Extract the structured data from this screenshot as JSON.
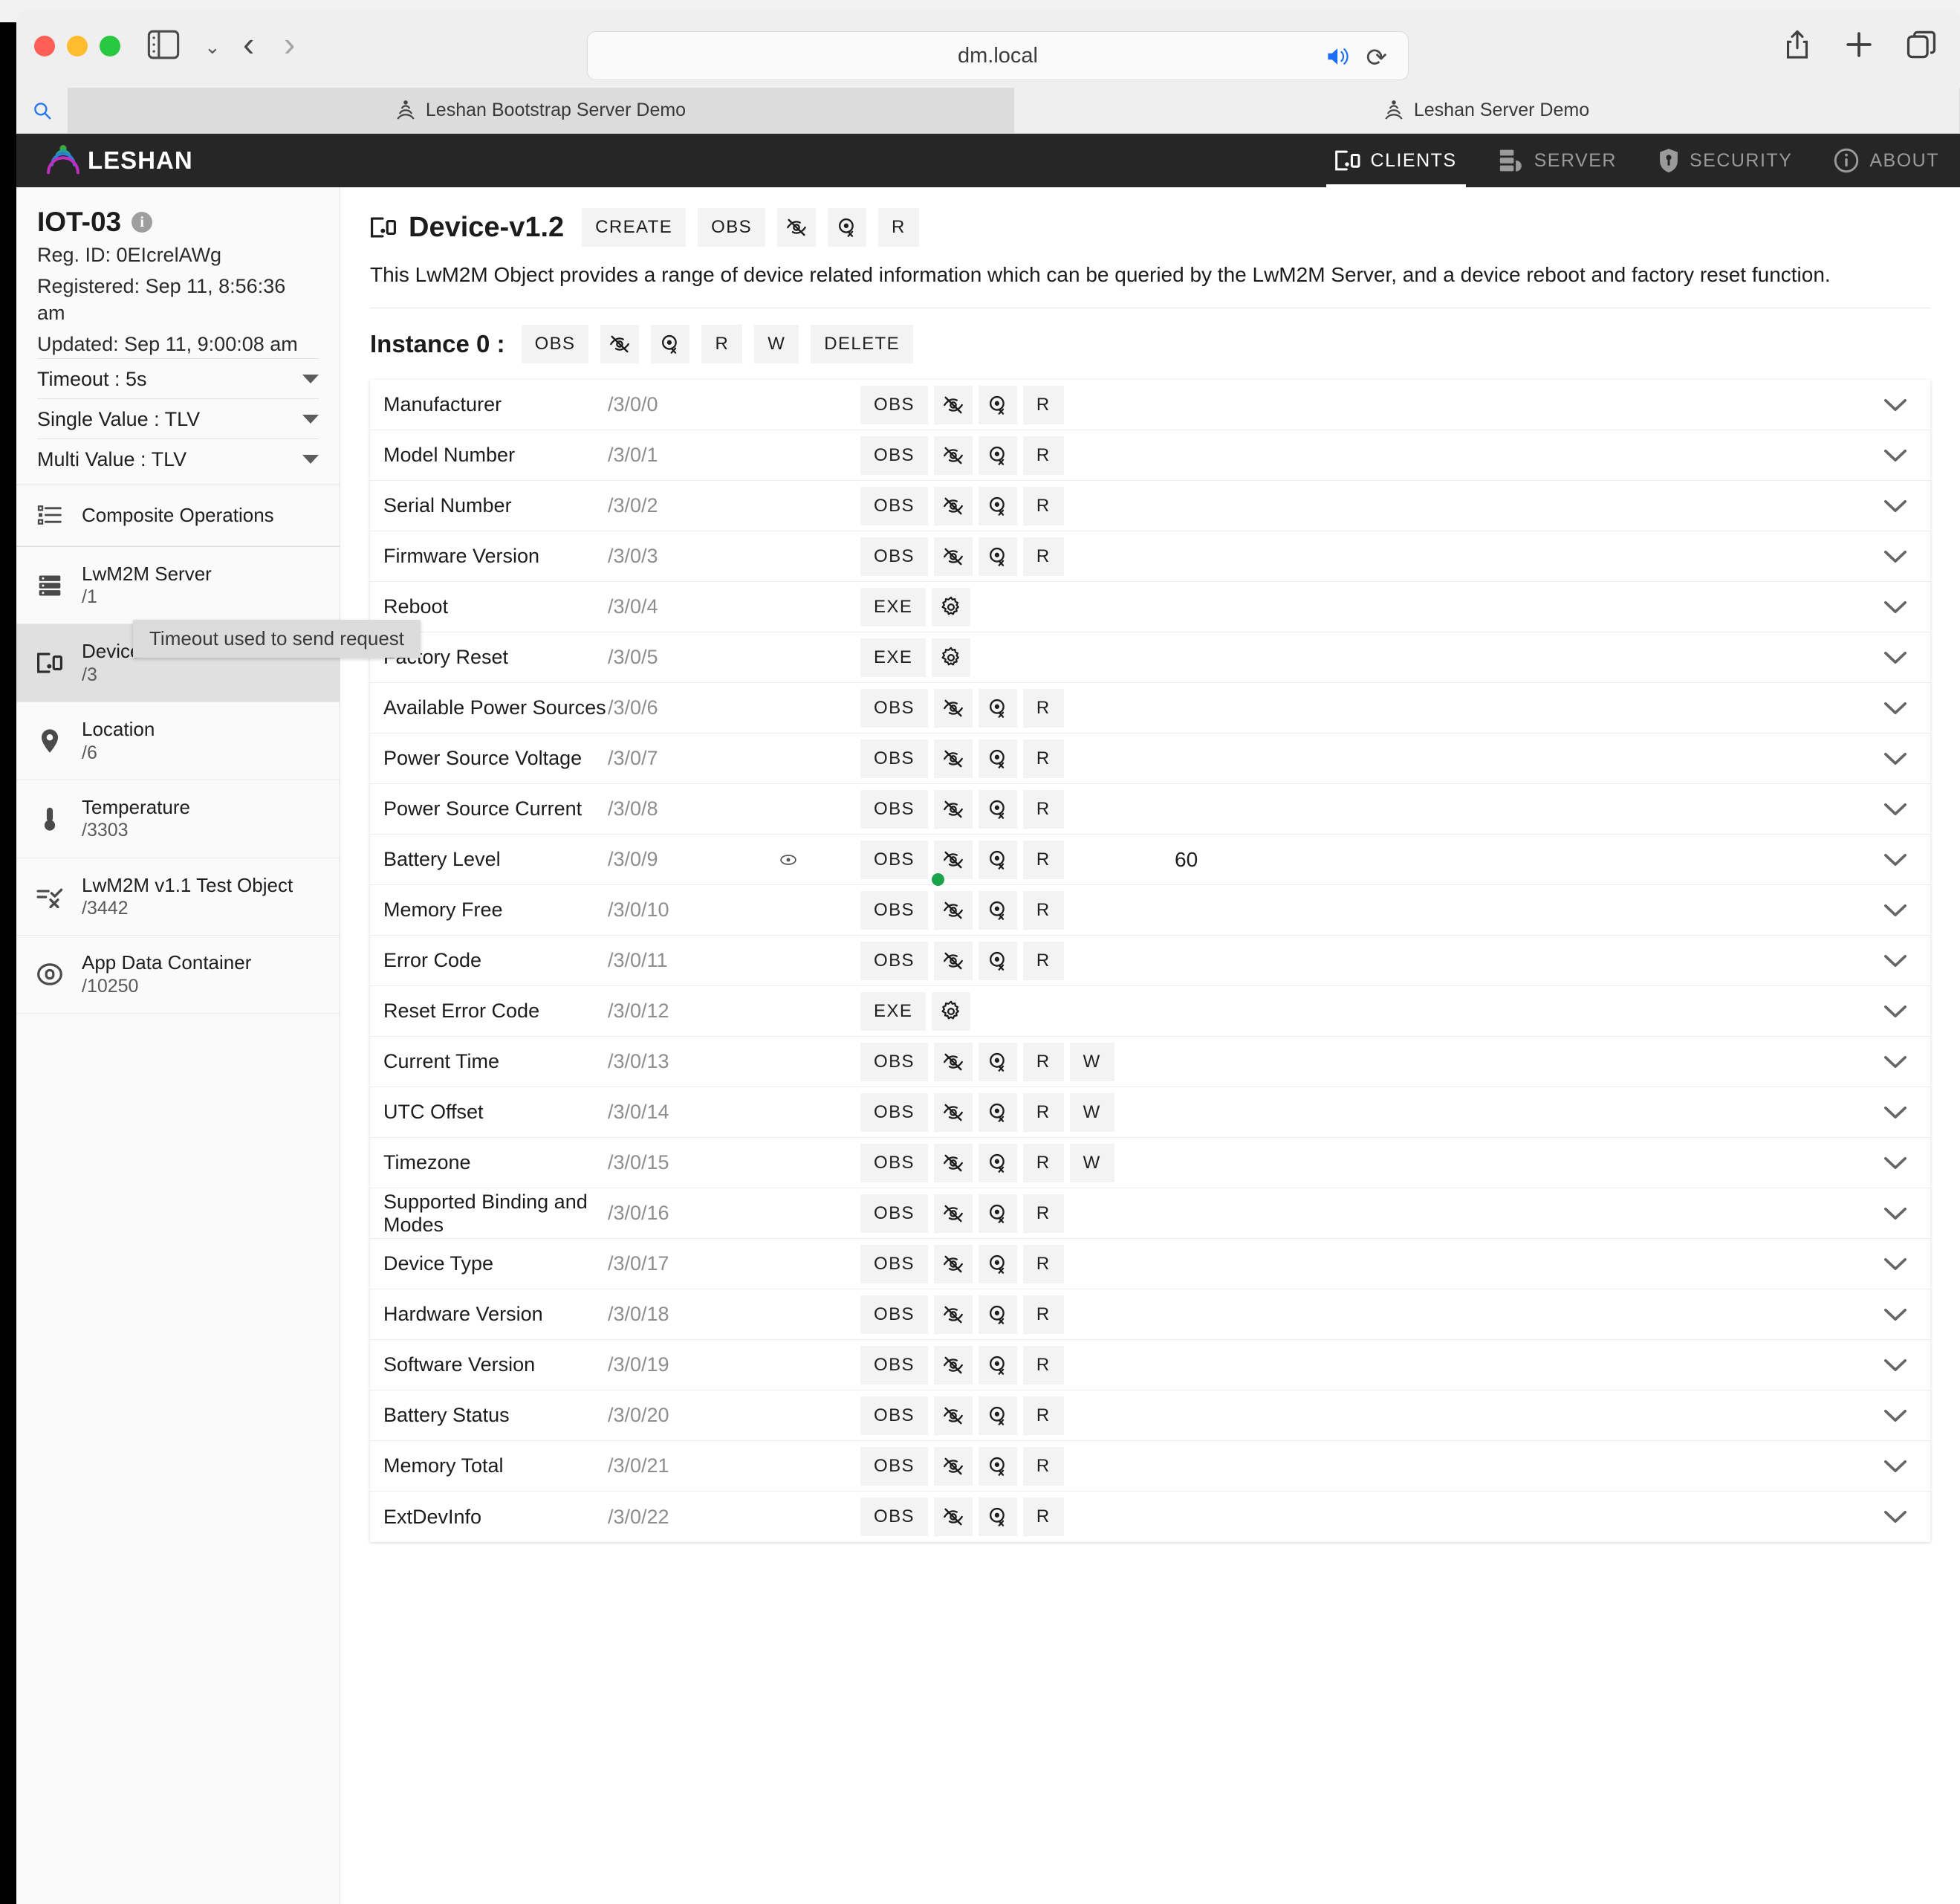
{
  "browser": {
    "url": "dm.local",
    "tabs": [
      {
        "title": "Leshan Bootstrap Server Demo",
        "active": true
      },
      {
        "title": "Leshan Server Demo",
        "active": false
      }
    ],
    "icons": {
      "sidebar": "sidebar-toggle-icon",
      "back": "back-arrow-icon",
      "forward": "forward-arrow-icon",
      "speaker": "speaker-icon",
      "reload": "reload-icon",
      "share": "share-icon",
      "newtab": "plus-icon",
      "tabs": "tab-overview-icon",
      "search": "search-icon"
    }
  },
  "topnav": {
    "brand": "LESHAN",
    "items": [
      {
        "label": "CLIENTS",
        "icon": "device-icon",
        "active": true
      },
      {
        "label": "SERVER",
        "icon": "server-icon",
        "active": false
      },
      {
        "label": "SECURITY",
        "icon": "shield-key-icon",
        "active": false
      },
      {
        "label": "ABOUT",
        "icon": "info-circle-icon",
        "active": false
      }
    ]
  },
  "sidebar": {
    "device_name": "IOT-03",
    "reg_id": "Reg. ID: 0EIcrelAWg",
    "registered": "Registered: Sep 11, 8:56:36 am",
    "updated": "Updated: Sep 11, 9:00:08 am",
    "selects": [
      {
        "label": "Timeout : 5s"
      },
      {
        "label": "Single Value : TLV"
      },
      {
        "label": "Multi Value : TLV"
      }
    ],
    "tooltip": "Timeout used to send request",
    "composite": {
      "label": "Composite Operations",
      "icon": "list-icon"
    },
    "objects": [
      {
        "name": "LwM2M Server",
        "path": "/1",
        "icon": "server-icon",
        "selected": false
      },
      {
        "name": "Device",
        "path": "/3",
        "icon": "device-icon",
        "selected": true
      },
      {
        "name": "Location",
        "path": "/6",
        "icon": "map-pin-icon",
        "selected": false
      },
      {
        "name": "Temperature",
        "path": "/3303",
        "icon": "thermometer-icon",
        "selected": false
      },
      {
        "name": "LwM2M v1.1 Test Object",
        "path": "/3442",
        "icon": "test-object-icon",
        "selected": false
      },
      {
        "name": "App Data Container",
        "path": "/10250",
        "icon": "data-container-icon",
        "selected": false
      }
    ]
  },
  "main": {
    "object_title": "Device-v1.2",
    "object_icon": "device-icon",
    "object_buttons": [
      {
        "label": "CREATE",
        "kind": "text"
      },
      {
        "label": "OBS",
        "kind": "text"
      },
      {
        "label": "",
        "kind": "icon",
        "icon": "eye-off-icon"
      },
      {
        "label": "",
        "kind": "icon",
        "icon": "eye-check-icon"
      },
      {
        "label": "R",
        "kind": "text"
      }
    ],
    "description": "This LwM2M Object provides a range of device related information which can be queried by the LwM2M Server, and a device reboot and factory reset function.",
    "instance_label": "Instance 0 :",
    "instance_buttons": [
      {
        "label": "OBS",
        "kind": "text"
      },
      {
        "label": "",
        "kind": "icon",
        "icon": "eye-off-icon"
      },
      {
        "label": "",
        "kind": "icon",
        "icon": "eye-check-icon"
      },
      {
        "label": "R",
        "kind": "text"
      },
      {
        "label": "W",
        "kind": "text"
      },
      {
        "label": "DELETE",
        "kind": "text"
      }
    ],
    "resources": [
      {
        "name": "Manufacturer",
        "path": "/3/0/0",
        "ops": [
          "OBS",
          "eye-off-icon",
          "eye-check-icon",
          "R"
        ],
        "value": "",
        "eye": false,
        "obs_dot": false
      },
      {
        "name": "Model Number",
        "path": "/3/0/1",
        "ops": [
          "OBS",
          "eye-off-icon",
          "eye-check-icon",
          "R"
        ],
        "value": "",
        "eye": false,
        "obs_dot": false
      },
      {
        "name": "Serial Number",
        "path": "/3/0/2",
        "ops": [
          "OBS",
          "eye-off-icon",
          "eye-check-icon",
          "R"
        ],
        "value": "",
        "eye": false,
        "obs_dot": false
      },
      {
        "name": "Firmware Version",
        "path": "/3/0/3",
        "ops": [
          "OBS",
          "eye-off-icon",
          "eye-check-icon",
          "R"
        ],
        "value": "",
        "eye": false,
        "obs_dot": false
      },
      {
        "name": "Reboot",
        "path": "/3/0/4",
        "ops": [
          "EXE",
          "gear-icon"
        ],
        "value": "",
        "eye": false,
        "obs_dot": false
      },
      {
        "name": "Factory Reset",
        "path": "/3/0/5",
        "ops": [
          "EXE",
          "gear-icon"
        ],
        "value": "",
        "eye": false,
        "obs_dot": false
      },
      {
        "name": "Available Power Sources",
        "path": "/3/0/6",
        "ops": [
          "OBS",
          "eye-off-icon",
          "eye-check-icon",
          "R"
        ],
        "value": "",
        "eye": false,
        "obs_dot": false
      },
      {
        "name": "Power Source Voltage",
        "path": "/3/0/7",
        "ops": [
          "OBS",
          "eye-off-icon",
          "eye-check-icon",
          "R"
        ],
        "value": "",
        "eye": false,
        "obs_dot": false
      },
      {
        "name": "Power Source Current",
        "path": "/3/0/8",
        "ops": [
          "OBS",
          "eye-off-icon",
          "eye-check-icon",
          "R"
        ],
        "value": "",
        "eye": false,
        "obs_dot": false
      },
      {
        "name": "Battery Level",
        "path": "/3/0/9",
        "ops": [
          "OBS",
          "eye-off-icon",
          "eye-check-icon",
          "R"
        ],
        "value": "60",
        "eye": true,
        "obs_dot": true
      },
      {
        "name": "Memory Free",
        "path": "/3/0/10",
        "ops": [
          "OBS",
          "eye-off-icon",
          "eye-check-icon",
          "R"
        ],
        "value": "",
        "eye": false,
        "obs_dot": false
      },
      {
        "name": "Error Code",
        "path": "/3/0/11",
        "ops": [
          "OBS",
          "eye-off-icon",
          "eye-check-icon",
          "R"
        ],
        "value": "",
        "eye": false,
        "obs_dot": false
      },
      {
        "name": "Reset Error Code",
        "path": "/3/0/12",
        "ops": [
          "EXE",
          "gear-icon"
        ],
        "value": "",
        "eye": false,
        "obs_dot": false
      },
      {
        "name": "Current Time",
        "path": "/3/0/13",
        "ops": [
          "OBS",
          "eye-off-icon",
          "eye-check-icon",
          "R",
          "W"
        ],
        "value": "",
        "eye": false,
        "obs_dot": false
      },
      {
        "name": "UTC Offset",
        "path": "/3/0/14",
        "ops": [
          "OBS",
          "eye-off-icon",
          "eye-check-icon",
          "R",
          "W"
        ],
        "value": "",
        "eye": false,
        "obs_dot": false
      },
      {
        "name": "Timezone",
        "path": "/3/0/15",
        "ops": [
          "OBS",
          "eye-off-icon",
          "eye-check-icon",
          "R",
          "W"
        ],
        "value": "",
        "eye": false,
        "obs_dot": false
      },
      {
        "name": "Supported Binding and Modes",
        "path": "/3/0/16",
        "ops": [
          "OBS",
          "eye-off-icon",
          "eye-check-icon",
          "R"
        ],
        "value": "",
        "eye": false,
        "obs_dot": false
      },
      {
        "name": "Device Type",
        "path": "/3/0/17",
        "ops": [
          "OBS",
          "eye-off-icon",
          "eye-check-icon",
          "R"
        ],
        "value": "",
        "eye": false,
        "obs_dot": false
      },
      {
        "name": "Hardware Version",
        "path": "/3/0/18",
        "ops": [
          "OBS",
          "eye-off-icon",
          "eye-check-icon",
          "R"
        ],
        "value": "",
        "eye": false,
        "obs_dot": false
      },
      {
        "name": "Software Version",
        "path": "/3/0/19",
        "ops": [
          "OBS",
          "eye-off-icon",
          "eye-check-icon",
          "R"
        ],
        "value": "",
        "eye": false,
        "obs_dot": false
      },
      {
        "name": "Battery Status",
        "path": "/3/0/20",
        "ops": [
          "OBS",
          "eye-off-icon",
          "eye-check-icon",
          "R"
        ],
        "value": "",
        "eye": false,
        "obs_dot": false
      },
      {
        "name": "Memory Total",
        "path": "/3/0/21",
        "ops": [
          "OBS",
          "eye-off-icon",
          "eye-check-icon",
          "R"
        ],
        "value": "",
        "eye": false,
        "obs_dot": false
      },
      {
        "name": "ExtDevInfo",
        "path": "/3/0/22",
        "ops": [
          "OBS",
          "eye-off-icon",
          "eye-check-icon",
          "R"
        ],
        "value": "",
        "eye": false,
        "obs_dot": false
      }
    ]
  },
  "colors": {
    "nav_bg": "#262626",
    "accent_green": "#1aa349",
    "selected_row": "#e0e0e0",
    "button_bg": "#f3f3f3"
  }
}
